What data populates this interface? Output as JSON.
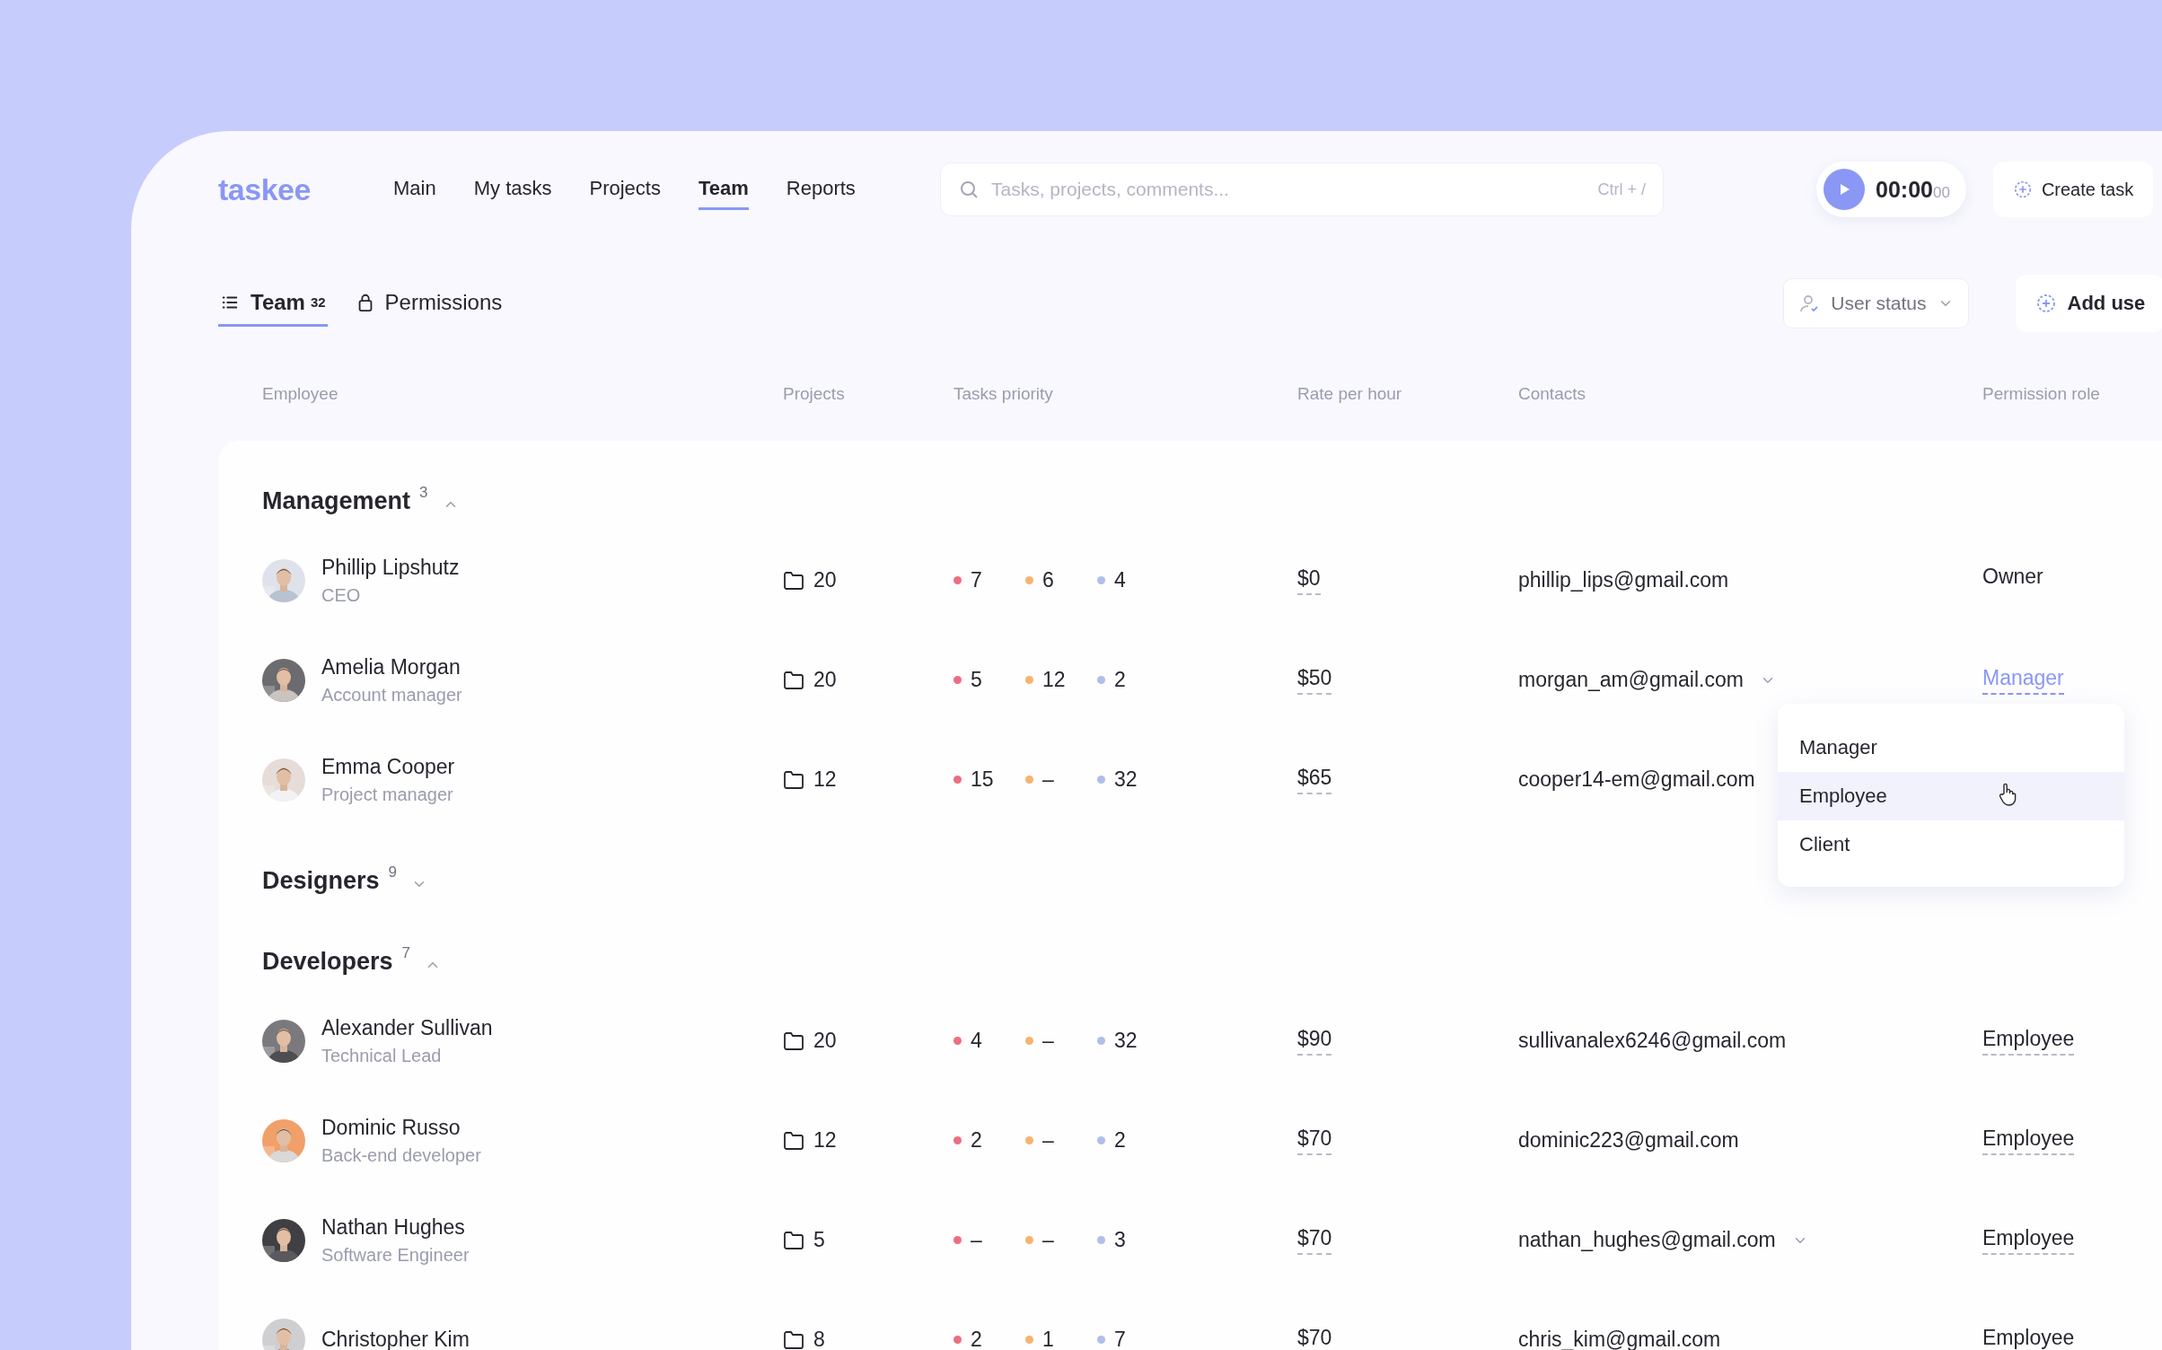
{
  "logo": "taskee",
  "nav": [
    {
      "label": "Main",
      "selected": false
    },
    {
      "label": "My tasks",
      "selected": false
    },
    {
      "label": "Projects",
      "selected": false
    },
    {
      "label": "Team",
      "selected": true
    },
    {
      "label": "Reports",
      "selected": false
    }
  ],
  "search": {
    "placeholder": "Tasks, projects, comments...",
    "shortcut": "Ctrl + /"
  },
  "timer": {
    "time": "00:00",
    "seconds": "00"
  },
  "create_button": "Create task",
  "tabs": [
    {
      "label": "Team",
      "count": "32",
      "kind": "list",
      "selected": true
    },
    {
      "label": "Permissions",
      "kind": "lock",
      "selected": false
    }
  ],
  "status_filter": "User status",
  "add_button": "Add use",
  "table": {
    "columns": [
      "Employee",
      "Projects",
      "Tasks priority",
      "Rate per hour",
      "Contacts",
      "Permission role"
    ],
    "groups": [
      {
        "name": "Management",
        "count": "3",
        "expanded": true,
        "rows": [
          {
            "name": "Phillip Lipshutz",
            "title": "CEO",
            "projects": "20",
            "priorities": [
              {
                "value": "7",
                "color": "#ee6d80"
              },
              {
                "value": "6",
                "color": "#f5b46f"
              },
              {
                "value": "4",
                "color": "#aebfe9"
              }
            ],
            "rate": "$0",
            "email": "phillip_lips@gmail.com",
            "hovered": false,
            "role": "Owner",
            "editable": false,
            "open": false
          },
          {
            "name": "Amelia Morgan",
            "title": "Account manager",
            "projects": "20",
            "priorities": [
              {
                "value": "5",
                "color": "#ee6d80"
              },
              {
                "value": "12",
                "color": "#f5b46f"
              },
              {
                "value": "2",
                "color": "#aebfe9"
              }
            ],
            "rate": "$50",
            "email": "morgan_am@gmail.com",
            "hovered": true,
            "role": "Manager",
            "editable": true,
            "open": true
          },
          {
            "name": "Emma Cooper",
            "title": "Project manager",
            "projects": "12",
            "priorities": [
              {
                "value": "15",
                "color": "#ee6d80"
              },
              {
                "value": "–",
                "color": "#f5b46f"
              },
              {
                "value": "32",
                "color": "#aebfe9"
              }
            ],
            "rate": "$65",
            "email": "cooper14-em@gmail.com",
            "hovered": false
          }
        ]
      },
      {
        "name": "Designers",
        "count": "9",
        "expanded": false
      },
      {
        "name": "Developers",
        "count": "7",
        "expanded": true,
        "rows": [
          {
            "name": "Alexander Sullivan",
            "title": "Technical Lead",
            "projects": "20",
            "priorities": [
              {
                "value": "4",
                "color": "#ee6d80"
              },
              {
                "value": "–",
                "color": "#f5b46f"
              },
              {
                "value": "32",
                "color": "#aebfe9"
              }
            ],
            "rate": "$90",
            "email": "sullivanalex6246@gmail.com",
            "hovered": false,
            "role": "Employee",
            "editable": true,
            "open": false
          },
          {
            "name": "Dominic Russo",
            "title": "Back-end developer",
            "projects": "12",
            "priorities": [
              {
                "value": "2",
                "color": "#ee6d80"
              },
              {
                "value": "–",
                "color": "#f5b46f"
              },
              {
                "value": "2",
                "color": "#aebfe9"
              }
            ],
            "rate": "$70",
            "email": "dominic223@gmail.com",
            "hovered": false,
            "role": "Employee",
            "editable": true,
            "open": false
          },
          {
            "name": "Nathan Hughes",
            "title": "Software Engineer",
            "projects": "5",
            "priorities": [
              {
                "value": "–",
                "color": "#ee6d80"
              },
              {
                "value": "–",
                "color": "#f5b46f"
              },
              {
                "value": "3",
                "color": "#aebfe9"
              }
            ],
            "rate": "$70",
            "email": "nathan_hughes@gmail.com",
            "hovered": true,
            "role": "Employee",
            "editable": true,
            "open": false
          },
          {
            "name": "Christopher Kim",
            "projects": "8",
            "priorities": [
              {
                "value": "2",
                "color": "#ee6d80"
              },
              {
                "value": "1",
                "color": "#f5b46f"
              },
              {
                "value": "7",
                "color": "#aebfe9"
              }
            ],
            "rate": "$70",
            "email": "chris_kim@gmail.com",
            "hovered": false,
            "role": "Employee",
            "editable": true,
            "open": false
          }
        ]
      }
    ]
  },
  "role_menu": {
    "items": [
      {
        "label": "Manager",
        "selected": false
      },
      {
        "label": "Employee",
        "selected": true
      },
      {
        "label": "Client",
        "selected": false
      }
    ]
  }
}
